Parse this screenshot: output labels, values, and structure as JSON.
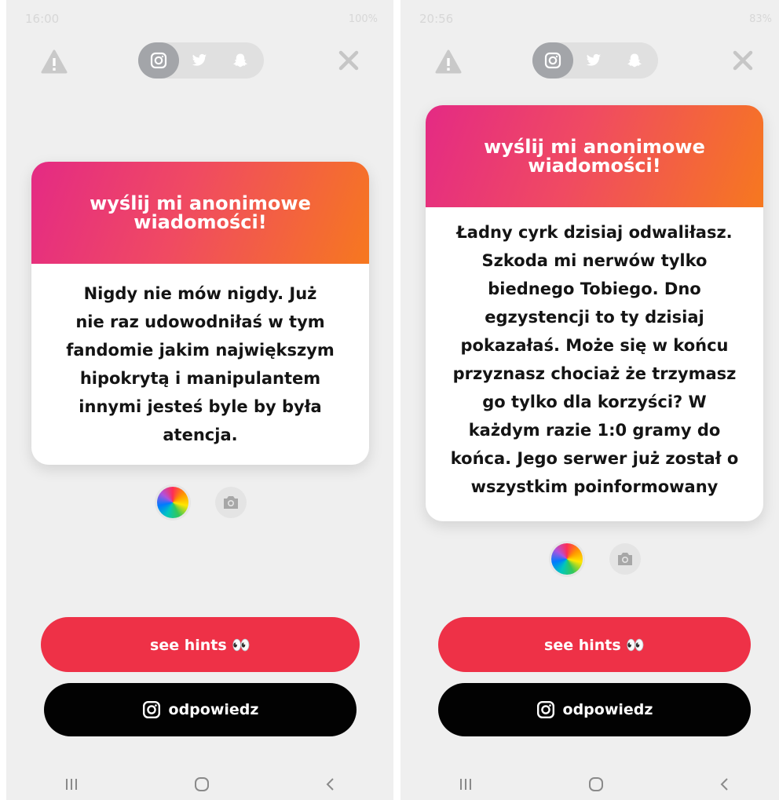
{
  "left": {
    "status": {
      "time": "16:00",
      "battery": "100%"
    },
    "social_tabs": [
      "instagram",
      "twitter",
      "snapchat"
    ],
    "active_tab": "instagram",
    "card": {
      "header": "wyślij mi anonimowe wiadomości!",
      "message_lines": [
        "Nigdy nie mów nigdy. Już",
        "nie raz udowodniłaś w tym",
        "fandomie jakim największym",
        "hipokrytą i manipulantem",
        "innymi jesteś byle by była",
        "atencja."
      ]
    },
    "hints_label": "see hints 👀",
    "reply_label": "odpowiedz"
  },
  "right": {
    "status": {
      "time": "20:56",
      "battery": "83%"
    },
    "social_tabs": [
      "instagram",
      "twitter",
      "snapchat"
    ],
    "active_tab": "instagram",
    "card": {
      "header": "wyślij mi anonimowe wiadomości!",
      "message_lines": [
        "Ładny cyrk dzisiaj odwaliłasz.",
        "Szkoda mi nerwów tylko",
        "biednego Tobiego. Dno",
        "egzystencji to ty dzisiaj",
        "pokazałaś. Może się w końcu",
        "przyznasz chociaż że trzymasz",
        "go tylko dla korzyści? W",
        "każdym razie 1:0 gramy do",
        "końca. Jego serwer już został o",
        "wszystkim poinformowany"
      ]
    },
    "hints_label": "see hints 👀",
    "reply_label": "odpowiedz"
  },
  "colors": {
    "gradient_start": "#e42a84",
    "gradient_end": "#f6781f",
    "hints_button": "#ee3147",
    "reply_button": "#020202",
    "background": "#efefef"
  },
  "icons": [
    "warning-icon",
    "instagram-icon",
    "twitter-icon",
    "snapchat-icon",
    "close-icon",
    "color-wheel-icon",
    "camera-icon",
    "recent-apps-icon",
    "home-icon",
    "back-icon"
  ]
}
